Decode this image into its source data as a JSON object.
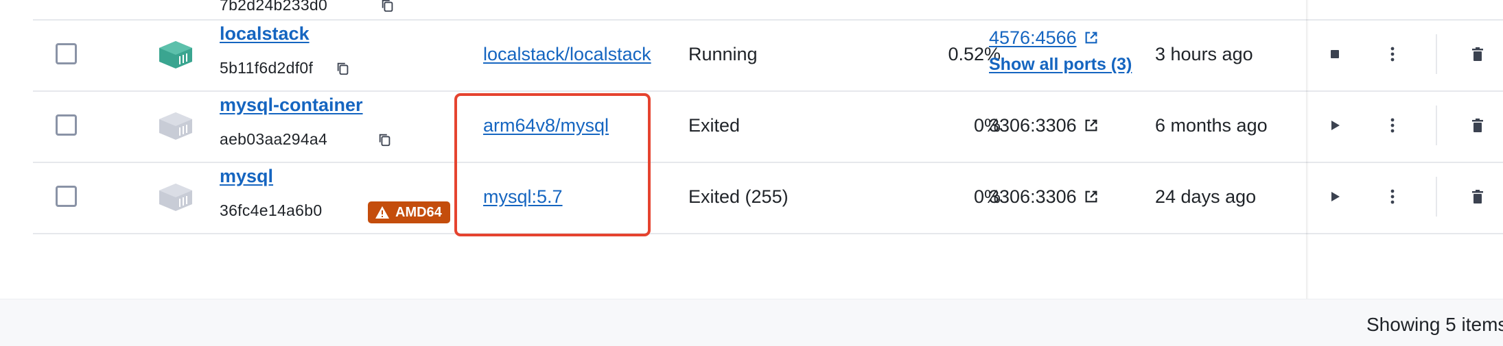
{
  "rows": [
    {
      "name": "",
      "id": "7b2d24b233d0",
      "image": "",
      "status": "",
      "cpu": "",
      "port": "",
      "started": ""
    },
    {
      "name": "localstack",
      "id": "5b11f6d2df0f",
      "image": "localstack/localstack",
      "status": "Running",
      "cpu": "0.52%",
      "port": "4576:4566",
      "ports_more": "Show all ports (3)",
      "started": "3 hours ago",
      "state_color": "#3aa590"
    },
    {
      "name": "mysql-container",
      "id": "aeb03aa294a4",
      "image": "arm64v8/mysql",
      "status": "Exited",
      "cpu": "0%",
      "port": "3306:3306",
      "started": "6 months ago",
      "state_color": "#c8ccd6"
    },
    {
      "name": "mysql",
      "id": "36fc4e14a6b0",
      "badge": "AMD64",
      "image": "mysql:5.7",
      "status": "Exited (255)",
      "cpu": "0%",
      "port": "3306:3306",
      "started": "24 days ago",
      "state_color": "#c8ccd6"
    }
  ],
  "footer": {
    "text": "Showing 5 items"
  },
  "icons": {
    "copy": "copy-icon",
    "external": "external-link-icon",
    "stop": "stop-icon",
    "start": "play-icon",
    "more": "more-vertical-icon",
    "delete": "trash-icon",
    "warning": "warning-icon",
    "container": "container-icon"
  },
  "colors": {
    "link": "#1565c0",
    "highlight": "#e5432f",
    "badge": "#c44d0c"
  }
}
